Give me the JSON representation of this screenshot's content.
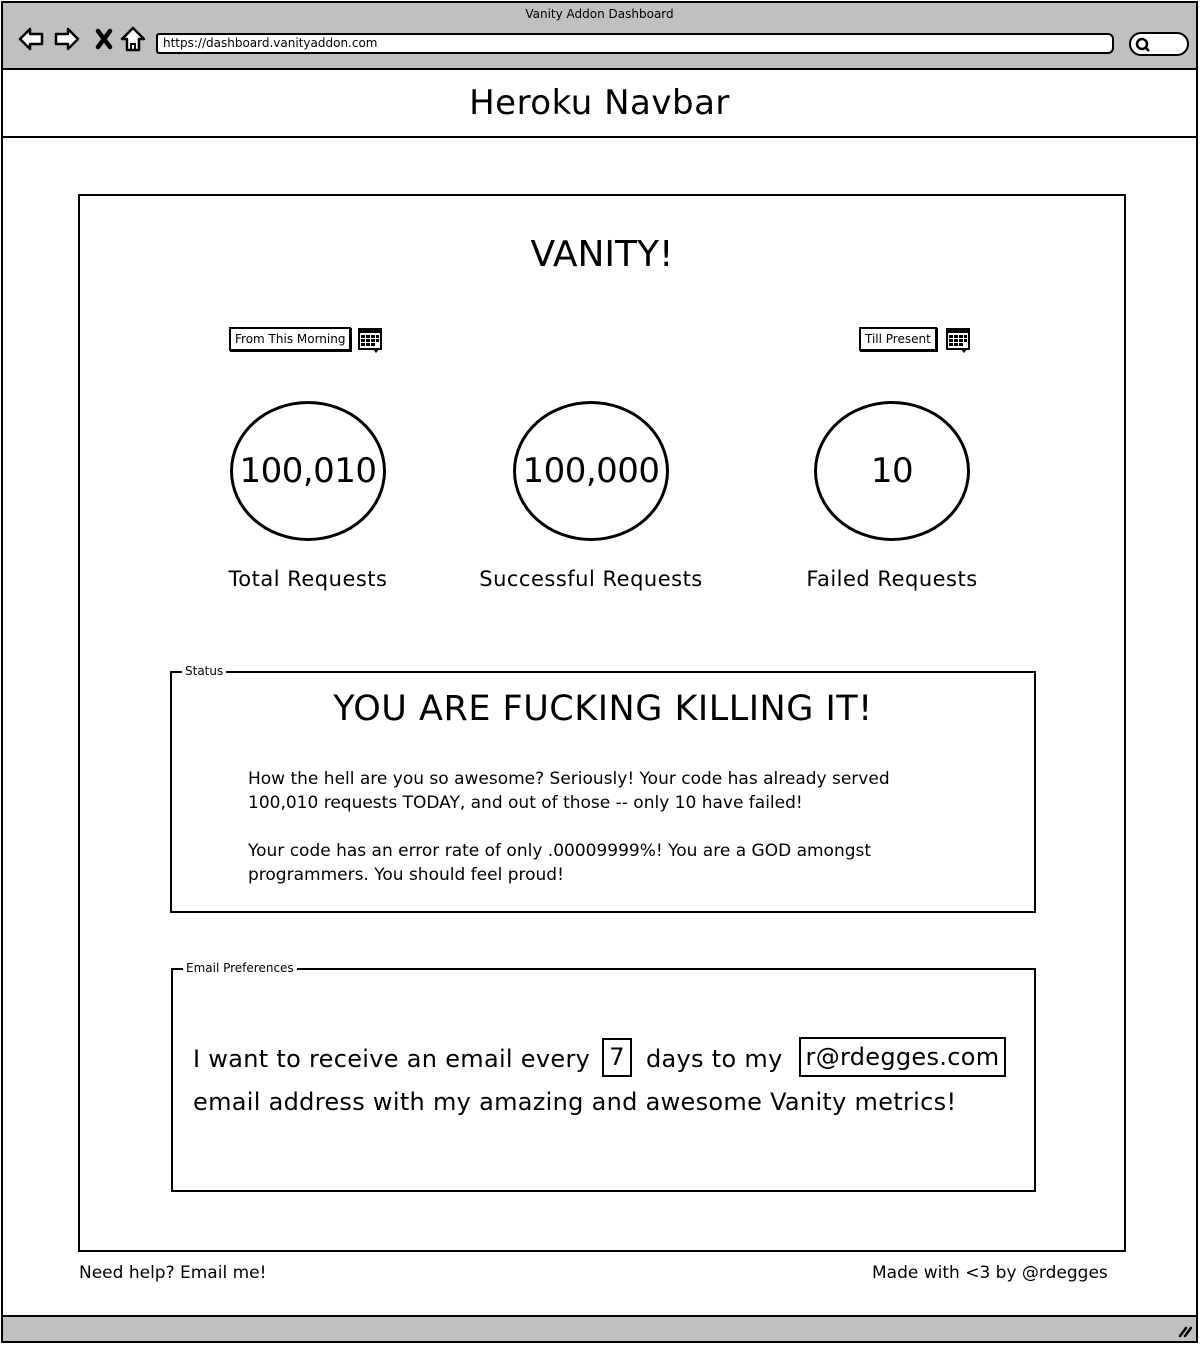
{
  "browser": {
    "window_title": "Vanity Addon Dashboard",
    "url": "https://dashboard.vanityaddon.com",
    "nav_icons": [
      "back-arrow-icon",
      "forward-arrow-icon",
      "close-x-icon",
      "home-icon"
    ],
    "search_icon": "search-icon"
  },
  "navbar": {
    "title": "Heroku Navbar"
  },
  "main": {
    "title": "VANITY!",
    "date_range": {
      "from_label": "From This Morning",
      "to_label": "Till Present",
      "icon": "calendar-icon"
    },
    "stats": [
      {
        "value": "100,010",
        "label": "Total Requests"
      },
      {
        "value": "100,000",
        "label": "Successful Requests"
      },
      {
        "value": "10",
        "label": "Failed Requests"
      }
    ],
    "status": {
      "legend": "Status",
      "headline": "YOU ARE FUCKING KILLING IT!",
      "paragraph1_line1": "How the hell are you so awesome?  Seriously!  Your code has already served",
      "paragraph1_line2": "100,010 requests TODAY, and out of those -- only 10 have failed!",
      "paragraph2_line1": "Your code has an error rate of only .00009999%!  You are a GOD amongst",
      "paragraph2_line2": "programmers. You should feel proud!"
    },
    "email_prefs": {
      "legend": "Email Preferences",
      "text_before_days": "I want to receive an email every",
      "days_value": "7",
      "text_after_days": "days to my",
      "email_value": "r@rdegges.com",
      "text_line2": "email address with my amazing and awesome Vanity metrics!"
    }
  },
  "footer": {
    "help_text": "Need help?  Email me!",
    "credit_text": "Made with <3 by @rdegges"
  }
}
